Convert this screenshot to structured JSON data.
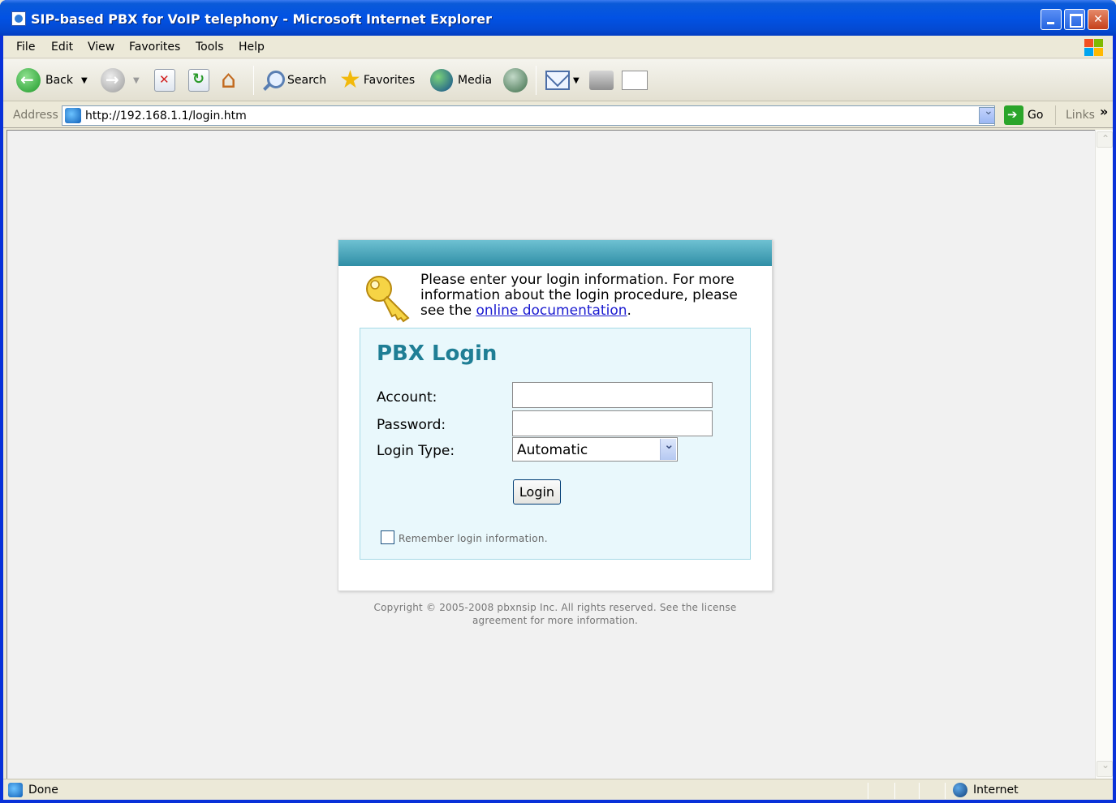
{
  "window": {
    "title": "SIP-based PBX for VoIP telephony - Microsoft Internet Explorer"
  },
  "menu": {
    "items": [
      "File",
      "Edit",
      "View",
      "Favorites",
      "Tools",
      "Help"
    ]
  },
  "toolbar": {
    "back_label": "Back",
    "search_label": "Search",
    "favorites_label": "Favorites",
    "media_label": "Media"
  },
  "address": {
    "label": "Address",
    "url": "http://192.168.1.1/login.htm",
    "go_label": "Go",
    "links_label": "Links"
  },
  "login": {
    "intro_text": "Please enter your login information. For more information about the login procedure, please see the ",
    "intro_link": "online documentation",
    "intro_end": ".",
    "title": "PBX Login",
    "account_label": "Account:",
    "account_value": "",
    "password_label": "Password:",
    "password_value": "",
    "login_type_label": "Login Type:",
    "login_type_value": "Automatic",
    "login_button": "Login",
    "remember_label": "Remember login information.",
    "remember_checked": false
  },
  "footer": {
    "copyright_line1": "Copyright © 2005-2008 pbxnsip Inc. All rights reserved. See the license",
    "copyright_line2": "agreement for more information."
  },
  "status": {
    "text": "Done",
    "zone": "Internet"
  },
  "icons": {
    "back": "back-arrow-icon",
    "forward": "forward-arrow-icon",
    "stop": "stop-icon",
    "refresh": "refresh-icon",
    "home": "home-icon",
    "search": "magnifier-icon",
    "favorites": "star-icon",
    "media": "media-icon",
    "history": "history-icon",
    "mail": "mail-icon",
    "print": "printer-icon",
    "edit": "edit-icon",
    "key": "key-icon"
  },
  "colors": {
    "titlebar": "#0252e4",
    "panel_header": "#2f8ea6",
    "login_title": "#1f7e95",
    "login_box_bg": "#e9f8fc",
    "link": "#1a1ad0"
  }
}
